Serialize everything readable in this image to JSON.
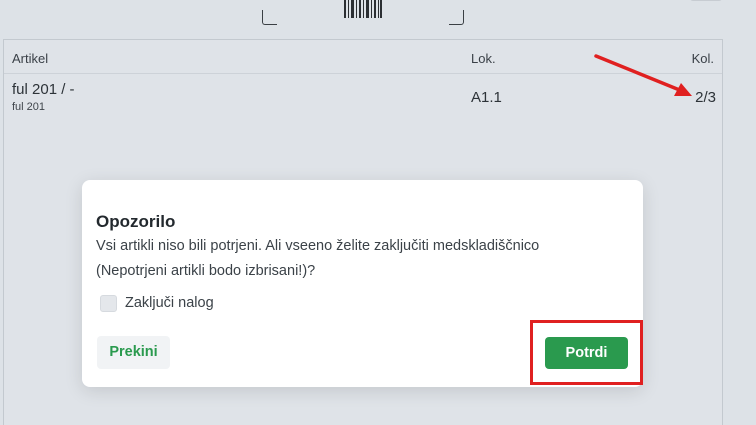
{
  "table": {
    "headers": {
      "artikel": "Artikel",
      "lok": "Lok.",
      "kol": "Kol."
    },
    "rows": [
      {
        "name": "ful 201 / -",
        "sub": "ful 201",
        "location": "A1.1",
        "quantity": "2/3"
      }
    ]
  },
  "dialog": {
    "title": "Opozorilo",
    "message_line1": "Vsi artikli niso bili potrjeni. Ali vseeno želite zaključiti medskladiščnico",
    "message_line2": "(Nepotrjeni artikli bodo izbrisani!)?",
    "checkbox_label": "Zaključi nalog",
    "checkbox_checked": false,
    "cancel_label": "Prekini",
    "confirm_label": "Potrdi"
  },
  "icons": {
    "barcode": "barcode-icon",
    "scan_frame": "scan-frame-icon"
  },
  "colors": {
    "accent_green": "#2a9a4e",
    "annotation_red": "#e02020",
    "background": "#dde2e7"
  }
}
